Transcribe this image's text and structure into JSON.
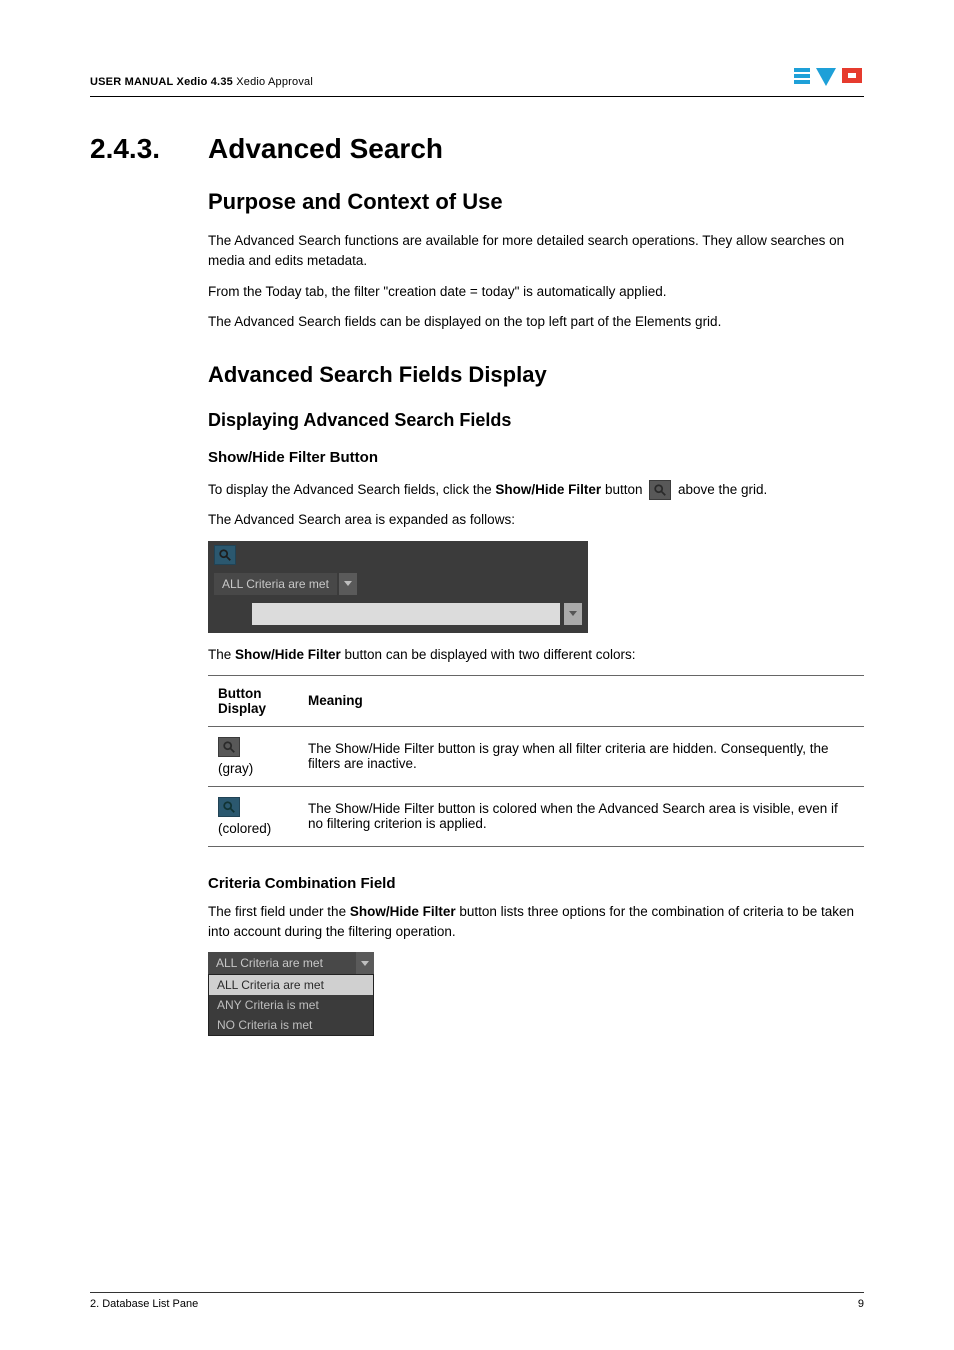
{
  "header": {
    "manual_prefix": "USER MANUAL",
    "product": " Xedio 4.35 ",
    "module": "Xedio Approval"
  },
  "section": {
    "number": "2.4.3.",
    "title": "Advanced Search"
  },
  "purpose": {
    "heading": "Purpose and Context of Use",
    "p1": "The Advanced Search functions are available for more detailed search operations. They allow searches on media and edits metadata.",
    "p2": "From the Today tab, the filter \"creation date = today\" is automatically applied.",
    "p3": "The Advanced Search fields can be displayed on the top left part of the Elements grid."
  },
  "asfd": {
    "heading": "Advanced Search Fields Display",
    "sub1": "Displaying Advanced Search Fields",
    "show_hide": {
      "heading": "Show/Hide Filter Button",
      "p1_a": "To display the Advanced Search fields, click the ",
      "p1_bold": "Show/Hide Filter",
      "p1_b": " button ",
      "p1_c": " above the grid.",
      "p2": "The Advanced Search area is expanded as follows:",
      "area_dropdown_label": "ALL Criteria are met",
      "p3_a": "The ",
      "p3_bold": "Show/Hide Filter",
      "p3_b": " button can be displayed with two different colors:"
    },
    "table": {
      "head_col1": "Button Display",
      "head_col2": "Meaning",
      "row1_label": "(gray)",
      "row1_a": "The ",
      "row1_bold": "Show/Hide Filter",
      "row1_b": " button is gray when all filter criteria are hidden. Consequently, the filters are inactive.",
      "row2_label": "(colored)",
      "row2_a": "The ",
      "row2_bold": "Show/Hide Filter",
      "row2_b": " button is colored when the Advanced Search area is visible, even if no filtering criterion is applied."
    },
    "ccf": {
      "heading": "Criteria Combination Field",
      "p1_a": "The first field under the ",
      "p1_bold": "Show/Hide Filter",
      "p1_b": " button lists three options for the combination of criteria to be taken into account during the filtering operation.",
      "selected": "ALL Criteria are met",
      "opts": [
        "ALL Criteria are met",
        "ANY Criteria is met",
        "NO Criteria is met"
      ]
    }
  },
  "footer": {
    "left": "2. Database List Pane",
    "right": "9"
  }
}
